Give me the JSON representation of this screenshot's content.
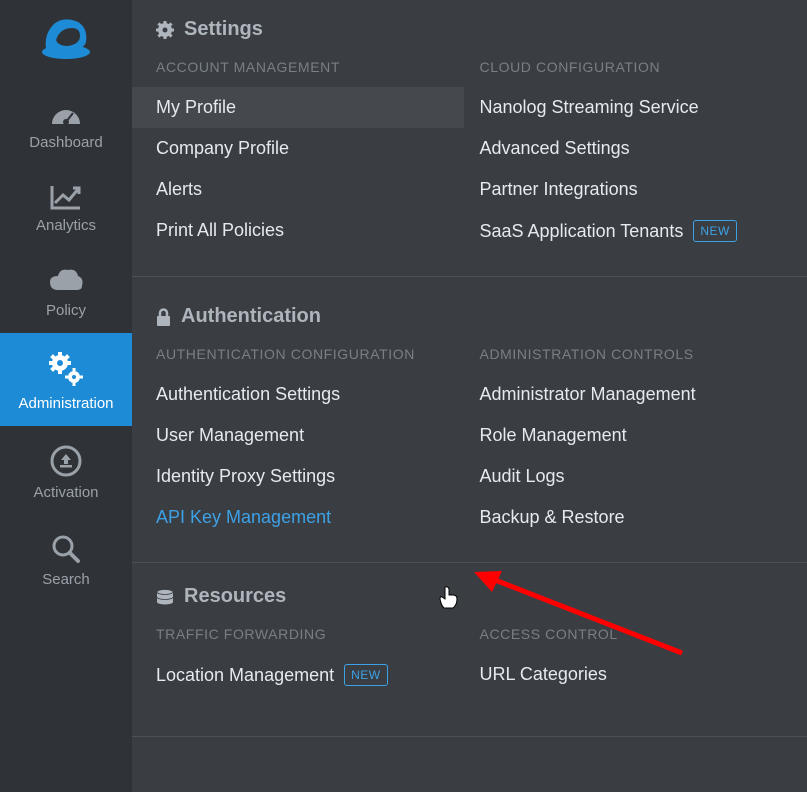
{
  "sidebar": {
    "items": [
      {
        "label": "Dashboard"
      },
      {
        "label": "Analytics"
      },
      {
        "label": "Policy"
      },
      {
        "label": "Administration"
      },
      {
        "label": "Activation"
      },
      {
        "label": "Search"
      }
    ]
  },
  "sections": {
    "settings": {
      "title": "Settings",
      "left_header": "ACCOUNT MANAGEMENT",
      "right_header": "CLOUD CONFIGURATION",
      "left_items": [
        "My Profile",
        "Company Profile",
        "Alerts",
        "Print All Policies"
      ],
      "right_items": [
        "Nanolog Streaming Service",
        "Advanced Settings",
        "Partner Integrations",
        "SaaS Application Tenants"
      ],
      "right_badge": "NEW"
    },
    "auth": {
      "title": "Authentication",
      "left_header": "AUTHENTICATION CONFIGURATION",
      "right_header": "ADMINISTRATION CONTROLS",
      "left_items": [
        "Authentication Settings",
        "User Management",
        "Identity Proxy Settings",
        "API Key Management"
      ],
      "right_items": [
        "Administrator Management",
        "Role Management",
        "Audit Logs",
        "Backup & Restore"
      ]
    },
    "resources": {
      "title": "Resources",
      "left_header": "TRAFFIC FORWARDING",
      "right_header": "ACCESS CONTROL",
      "left_items": [
        "Location Management"
      ],
      "left_badge": "NEW",
      "right_items": [
        "URL Categories"
      ]
    }
  }
}
